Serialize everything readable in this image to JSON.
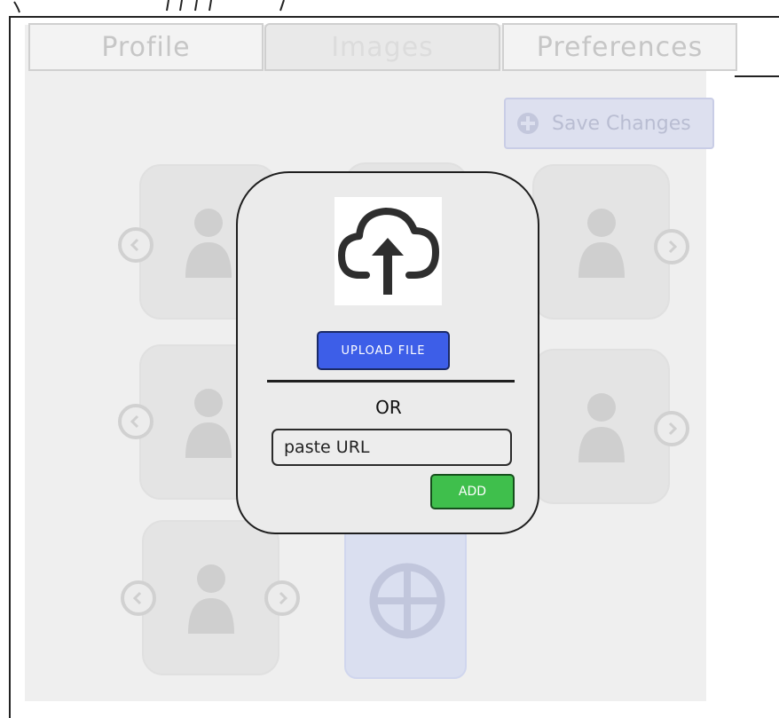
{
  "tabs": [
    {
      "label": "Profile"
    },
    {
      "label": "Images"
    },
    {
      "label": "Preferences"
    }
  ],
  "toolbar": {
    "save_label": "Save Changes"
  },
  "modal": {
    "upload_label": "UPLOAD FILE",
    "or_label": "OR",
    "url_placeholder": "paste URL",
    "add_label": "ADD"
  },
  "colors": {
    "upload_button": "#3d5ee8",
    "add_button": "#3fbf4c",
    "save_button": "#dde0ef",
    "add_image_card": "#dadff0"
  },
  "icons": [
    "cloud-upload-icon",
    "add-circle-icon",
    "person-icon",
    "chevron-left-icon",
    "chevron-right-icon"
  ]
}
